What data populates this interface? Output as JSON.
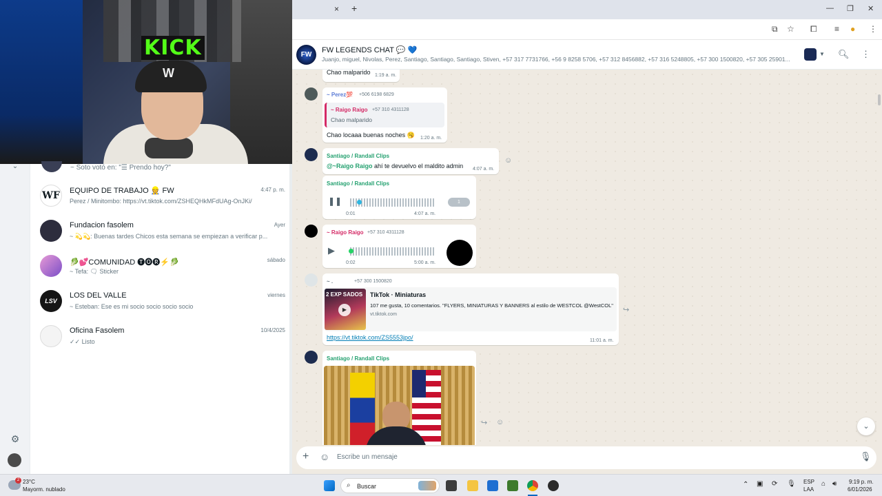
{
  "webcam": {
    "overlay_text": "KICK"
  },
  "browser": {
    "tab_close": "×",
    "tab_new": "+",
    "window_controls": [
      "—",
      "❐",
      "✕"
    ],
    "toolbar_icons": [
      "install-icon",
      "star-icon",
      "extensions-icon",
      "media-icon",
      "profile-icon",
      "menu-icon"
    ]
  },
  "sidebar": {
    "partial_item": "~ Soto votó en: \"☰ Prendo hoy?\"",
    "items": [
      {
        "name": "EQUIPO DE TRABAJO 👷 FW",
        "time": "4:47 p. m.",
        "last": "Perez / Minitombo: https://vt.tiktok.com/ZSHEQHkMFdUAg-OnJKi/",
        "avatar_color": "#ffffff"
      },
      {
        "name": "Fundacion fasolem",
        "time": "Ayer",
        "last": "~ 💫💫: Buenas tardes  Chicos esta semana se empiezan a verificar p...",
        "avatar_color": "#2d2d3d"
      },
      {
        "name": "🥬💕COMUNIDAD 🅣🅞🅡⚡🥬",
        "time": "sábado",
        "last": "~ Tefa: 🗨 Sticker",
        "avatar_color": "#b06fc9"
      },
      {
        "name": "LOS DEL VALLE",
        "time": "viernes",
        "last": "~ Esteban: Ese es mi socio socio socio socio",
        "avatar_color": "#151515"
      },
      {
        "name": "Oficina Fasolem",
        "time": "10/4/2025",
        "last": "✓✓ Listo",
        "avatar_color": "#f4f4f4"
      }
    ],
    "settings_icon": "gear-icon"
  },
  "chat": {
    "title": "FW LEGENDS CHAT 💬 💙",
    "members": "Juanjo, miguel, Nivolas, Perez, Santiago, Santiago, Santiago, Stiven, +57 317 7731766, +56 9 8258 5706, +57 312 8456882, +57 316 5248805, +57 300 1500820, +57 305 25901...",
    "messages": {
      "m1": {
        "text": "Chao malparido",
        "time": "1:19 a. m."
      },
      "m2": {
        "sender": "~ Perez💯",
        "phone": "+506 6198 6829",
        "quote_sender": "~ Raigo Raigo",
        "quote_phone": "+57 310 4311128",
        "quote_text": "Chao malparido",
        "text": "Chao locaaa buenas noches 🥱",
        "time": "1:20 a. m."
      },
      "m3": {
        "sender": "Santiago / Randall Clips",
        "mention": "@~Raigo Raigo",
        "text": " ahí te devuelvo el maldito admin",
        "time": "4:07 a. m."
      },
      "m4": {
        "sender": "Santiago / Randall Clips",
        "duration": "0:01",
        "speed": "1",
        "time": "4:07 a. m."
      },
      "m5": {
        "sender": "~ Raigo Raigo",
        "phone": "+57 310 4311128",
        "duration": "0:02",
        "time": "5:00 a. m."
      },
      "m6": {
        "sender": "~ .",
        "phone": "+57 300 1500820",
        "card_title": "TikTok · Miniaturas",
        "card_desc": "107 me gusta, 10 comentarios. \"FLYERS, MINIATURAS Y BANNERS al estilo de WESTCOL @WestCOL\"",
        "card_domain": "vt.tiktok.com",
        "thumb_text": "2 EXP SADOS",
        "link": "https://vt.tiktok.com/ZS5553jpo/",
        "time": "11:01 a. m."
      },
      "m7": {
        "sender": "Santiago / Randall Clips"
      }
    },
    "composer_placeholder": "Escribe un mensaje",
    "colors": {
      "green_sender": "#25a170",
      "pink_sender": "#d42a66",
      "blue_sender": "#5b7bd5",
      "link": "#027eb5"
    }
  },
  "taskbar": {
    "weather_temp": "23°C",
    "weather_desc": "Mayorm. nublado",
    "weather_badge": "2",
    "search_label": "Buscar",
    "lang_top": "ESP",
    "lang_bottom": "LAA",
    "clock_time": "9:19 p. m.",
    "clock_date": "6/01/2026"
  }
}
